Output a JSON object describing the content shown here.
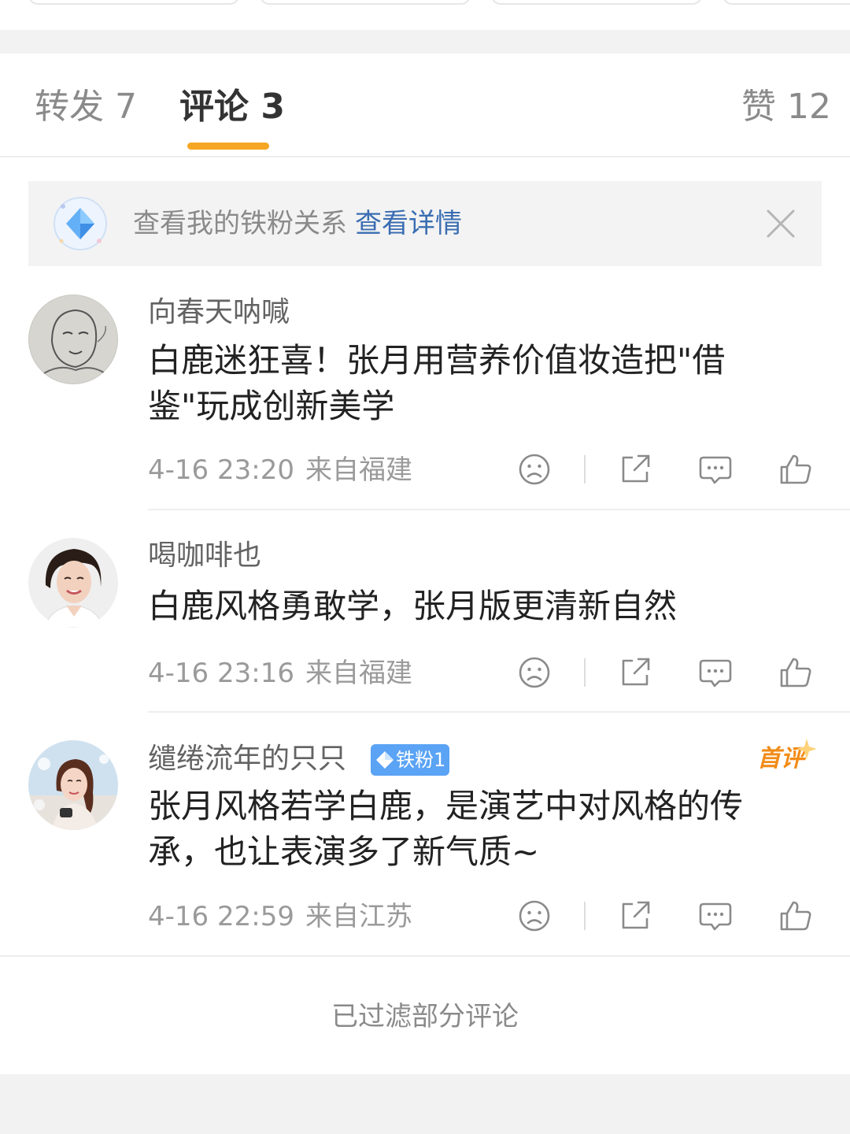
{
  "tabs": [
    {
      "label": "转发 7",
      "active": false
    },
    {
      "label": "评论 3",
      "active": true
    },
    {
      "label": "赞 12",
      "active": false
    }
  ],
  "accent_color": "#f5a623",
  "link_color": "#3a6db2",
  "fan_banner": {
    "text": "查看我的铁粉关系",
    "link": "查看详情",
    "icon": "diamond-badge-icon",
    "close_icon": "close-icon"
  },
  "comments": [
    {
      "username": "向春天呐喊",
      "text": "白鹿迷狂喜！张月用营养价值妆造把\"借鉴\"玩成创新美学",
      "time": "4-16 23:20",
      "location": "来自福建",
      "avatar": "sketch-portrait-avatar"
    },
    {
      "username": "喝咖啡也",
      "text": "白鹿风格勇敢学，张月版更清新自然",
      "time": "4-16 23:16",
      "location": "来自福建",
      "avatar": "woman-portrait-avatar"
    },
    {
      "username": "缱绻流年的只只",
      "badge": "铁粉1",
      "first_tag": "首评",
      "text": "张月风格若学白鹿，是演艺中对风格的传承，也让表演多了新气质~",
      "time": "4-16 22:59",
      "location": "来自江苏",
      "avatar": "girl-portrait-avatar"
    }
  ],
  "action_icons": [
    "dislike-face-icon",
    "share-icon",
    "reply-bubble-icon",
    "thumbs-up-icon"
  ],
  "footer": {
    "filter_note": "已过滤部分评论"
  }
}
